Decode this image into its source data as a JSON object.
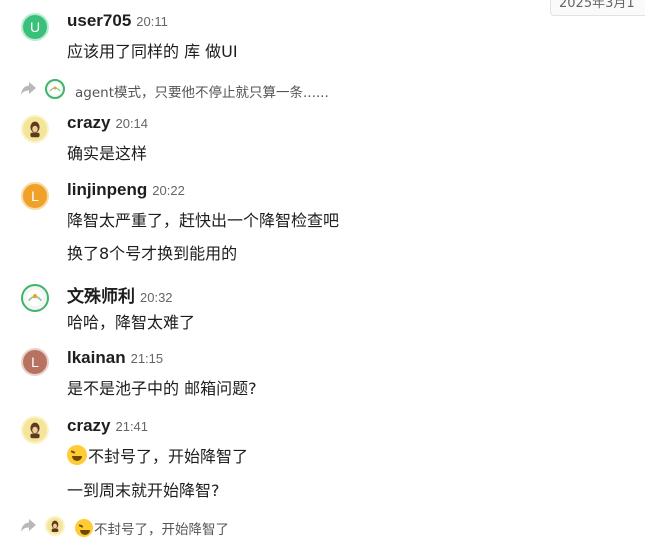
{
  "date_chip": "2025年3月1",
  "messages": [
    {
      "user": "user705",
      "time": "20:11",
      "avatar_letter": "U",
      "lines": [
        "应该用了同样的 库 做UI"
      ]
    },
    {
      "user": "crazy",
      "time": "20:14",
      "lines": [
        "确实是这样"
      ]
    },
    {
      "user": "linjinpeng",
      "time": "20:22",
      "avatar_letter": "L",
      "lines": [
        "降智太严重了，赶快出一个降智检查吧",
        "换了8个号才换到能用的"
      ]
    },
    {
      "user": "文殊师利",
      "time": "20:32",
      "lines": [
        "哈哈，降智太难了"
      ]
    },
    {
      "user": "lkainan",
      "time": "21:15",
      "avatar_letter": "L",
      "lines": [
        "是不是池子中的 邮箱问题?"
      ]
    },
    {
      "user": "crazy",
      "time": "21:41",
      "lines": [
        "不封号了，开始降智了",
        "一到周末就开始降智?"
      ]
    }
  ],
  "replies": [
    {
      "text": "agent模式，只要他不停止就只算一条......"
    },
    {
      "text": "不封号了，开始降智了"
    }
  ],
  "icons": {
    "reply": "reply-arrow-icon",
    "emoji": "rolling-laughing-emoji-icon"
  }
}
